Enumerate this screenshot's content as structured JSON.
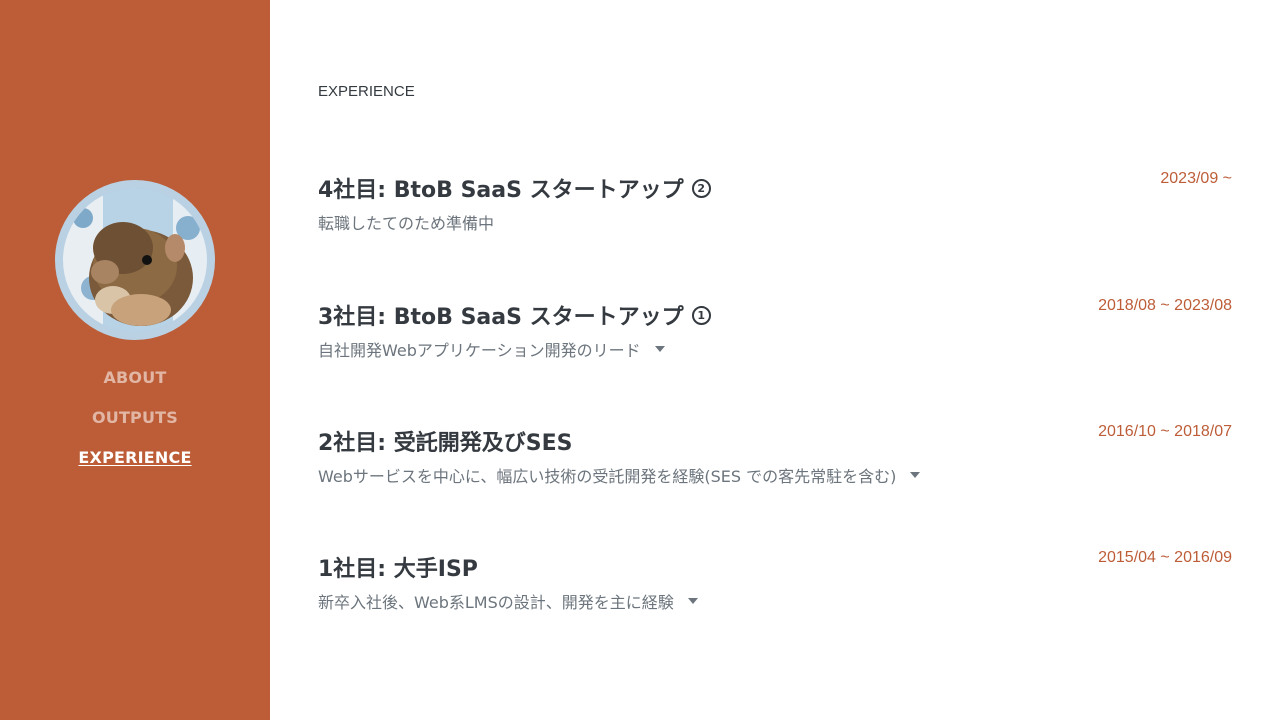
{
  "sidebar": {
    "nav": [
      {
        "label": "ABOUT",
        "active": false
      },
      {
        "label": "OUTPUTS",
        "active": false
      },
      {
        "label": "EXPERIENCE",
        "active": true
      }
    ],
    "accent_color": "#bd5d38"
  },
  "main": {
    "section_title": "EXPERIENCE",
    "jobs": [
      {
        "title": "4社目: BtoB SaaS スタートアップ",
        "badge": "2",
        "description": "転職したてのため準備中",
        "date": "2023/09 ~",
        "expandable": false
      },
      {
        "title": "3社目: BtoB SaaS スタートアップ",
        "badge": "1",
        "description": "自社開発Webアプリケーション開発のリード",
        "date": "2018/08 ~ 2023/08",
        "expandable": true
      },
      {
        "title": "2社目: 受託開発及びSES",
        "badge": "",
        "description": "Webサービスを中心に、幅広い技術の受託開発を経験(SES での客先常駐を含む)",
        "date": "2016/10 ~ 2018/07",
        "expandable": true
      },
      {
        "title": "1社目: 大手ISP",
        "badge": "",
        "description": "新卒入社後、Web系LMSの設計、開発を主に経験",
        "date": "2015/04 ~ 2016/09",
        "expandable": true
      }
    ]
  }
}
